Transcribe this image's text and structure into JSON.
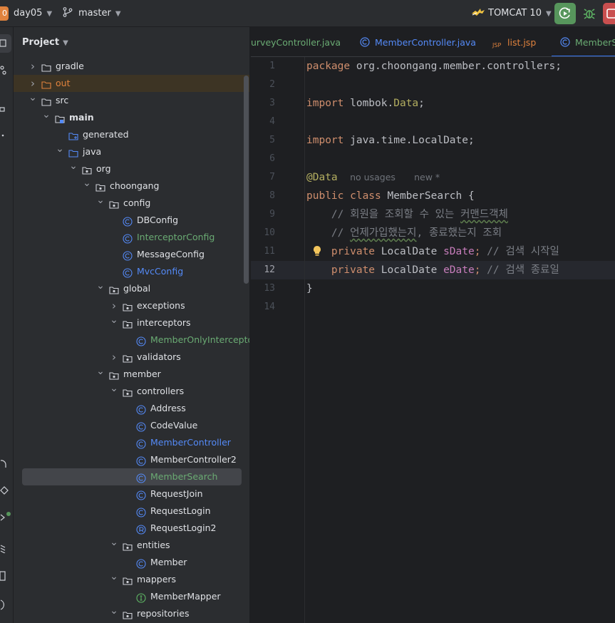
{
  "topbar": {
    "project_badge": "0",
    "project_name": "day05",
    "branch": "master",
    "run_config": "TOMCAT 10"
  },
  "project_panel": {
    "title": "Project",
    "tree": [
      {
        "label": "gradle",
        "type": "folder",
        "depth": 1,
        "arrow": "right"
      },
      {
        "label": "out",
        "type": "folder-orange",
        "depth": 1,
        "arrow": "right",
        "style": "orange",
        "highlight": true
      },
      {
        "label": "src",
        "type": "folder",
        "depth": 1,
        "arrow": "down"
      },
      {
        "label": "main",
        "type": "folder-module",
        "depth": 2,
        "arrow": "down",
        "style": "bold"
      },
      {
        "label": "generated",
        "type": "folder-gen",
        "depth": 3,
        "arrow": ""
      },
      {
        "label": "java",
        "type": "folder-blue",
        "depth": 3,
        "arrow": "down"
      },
      {
        "label": "org",
        "type": "package",
        "depth": 4,
        "arrow": "down"
      },
      {
        "label": "choongang",
        "type": "package",
        "depth": 5,
        "arrow": "down"
      },
      {
        "label": "config",
        "type": "package",
        "depth": 6,
        "arrow": "down"
      },
      {
        "label": "DBConfig",
        "type": "class",
        "depth": 7,
        "arrow": ""
      },
      {
        "label": "InterceptorConfig",
        "type": "class",
        "depth": 7,
        "arrow": "",
        "style": "green"
      },
      {
        "label": "MessageConfig",
        "type": "class",
        "depth": 7,
        "arrow": ""
      },
      {
        "label": "MvcConfig",
        "type": "class",
        "depth": 7,
        "arrow": "",
        "style": "blue"
      },
      {
        "label": "global",
        "type": "package",
        "depth": 6,
        "arrow": "down"
      },
      {
        "label": "exceptions",
        "type": "package",
        "depth": 7,
        "arrow": "right"
      },
      {
        "label": "interceptors",
        "type": "package",
        "depth": 7,
        "arrow": "down"
      },
      {
        "label": "MemberOnlyInterceptor",
        "type": "class",
        "depth": 8,
        "arrow": "",
        "style": "green"
      },
      {
        "label": "validators",
        "type": "package",
        "depth": 7,
        "arrow": "right"
      },
      {
        "label": "member",
        "type": "package",
        "depth": 6,
        "arrow": "down"
      },
      {
        "label": "controllers",
        "type": "package",
        "depth": 7,
        "arrow": "down"
      },
      {
        "label": "Address",
        "type": "class",
        "depth": 8,
        "arrow": ""
      },
      {
        "label": "CodeValue",
        "type": "class",
        "depth": 8,
        "arrow": ""
      },
      {
        "label": "MemberController",
        "type": "class",
        "depth": 8,
        "arrow": "",
        "style": "blue"
      },
      {
        "label": "MemberController2",
        "type": "class",
        "depth": 8,
        "arrow": ""
      },
      {
        "label": "MemberSearch",
        "type": "class",
        "depth": 8,
        "arrow": "",
        "style": "green",
        "selected": true
      },
      {
        "label": "RequestJoin",
        "type": "class",
        "depth": 8,
        "arrow": ""
      },
      {
        "label": "RequestLogin",
        "type": "class",
        "depth": 8,
        "arrow": ""
      },
      {
        "label": "RequestLogin2",
        "type": "record",
        "depth": 8,
        "arrow": ""
      },
      {
        "label": "entities",
        "type": "package",
        "depth": 7,
        "arrow": "down"
      },
      {
        "label": "Member",
        "type": "class",
        "depth": 8,
        "arrow": ""
      },
      {
        "label": "mappers",
        "type": "package",
        "depth": 7,
        "arrow": "down"
      },
      {
        "label": "MemberMapper",
        "type": "interface",
        "depth": 8,
        "arrow": ""
      },
      {
        "label": "repositories",
        "type": "package",
        "depth": 7,
        "arrow": "down"
      }
    ]
  },
  "editor": {
    "tabs": [
      {
        "label": "urveyController.java",
        "icon": "none",
        "style": "green"
      },
      {
        "label": "MemberController.java",
        "icon": "class",
        "style": "blue"
      },
      {
        "label": "list.jsp",
        "icon": "jsp",
        "style": "orange"
      },
      {
        "label": "MemberSe",
        "icon": "class",
        "style": "green",
        "active": true
      }
    ],
    "line_numbers": [
      "1",
      "2",
      "3",
      "4",
      "5",
      "6",
      "7",
      "8",
      "9",
      "10",
      "11",
      "12",
      "13",
      "14"
    ],
    "current_line": 12,
    "code": {
      "l1_kw": "package",
      "l1_rest": " org.choongang.member.controllers;",
      "l3_kw": "import",
      "l3_a": " lombok.",
      "l3_b": "Data",
      "l3_c": ";",
      "l5_kw": "import",
      "l5_rest": " java.time.LocalDate;",
      "l7_ann": "@Data",
      "l7_hint1": "no usages",
      "l7_hint2": "new *",
      "l8_kw": "public class",
      "l8_rest": " MemberSearch {",
      "l9_cm": "    // 회원을 조회할 수 있는 ",
      "l9_sq": "커맨드객체",
      "l10_cm": "    // ",
      "l10_sq": "언제가입했는지",
      "l10_cm2": ", 종료했는지 조회",
      "l11_kw": "    private",
      "l11_type": " LocalDate ",
      "l11_fld": "sDate",
      "l11_semi": ";",
      "l11_cm": " // 검색 시작일",
      "l12_kw": "    private",
      "l12_type": " LocalDate ",
      "l12_fld": "eDate",
      "l12_semi": ";",
      "l12_cm": " // 검색 종료일",
      "l13": "}"
    }
  },
  "colors": {
    "accent": "#3574f0",
    "run_button": "#57965c",
    "stop_button": "#c94f4f",
    "keyword": "#cf8e6d",
    "annotation": "#b3ae60",
    "field": "#c77dbb",
    "comment": "#7a7e85"
  }
}
